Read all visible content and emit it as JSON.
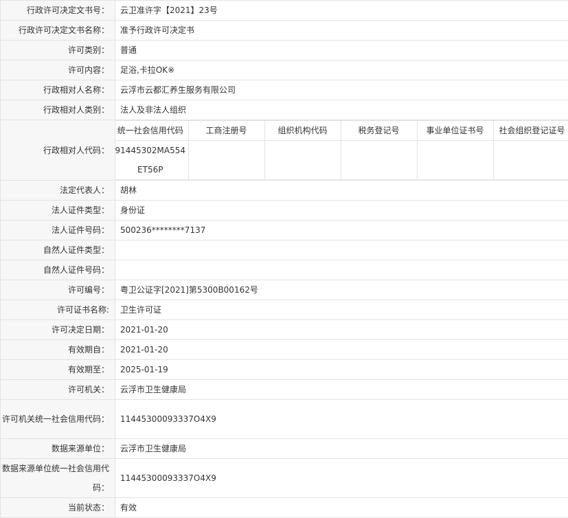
{
  "rows": [
    {
      "label": "行政许可决定文书号：",
      "value": "云卫准许字【2021】23号"
    },
    {
      "label": "行政许可决定文书名称：",
      "value": "准予行政许可决定书"
    },
    {
      "label": "许可类别：",
      "value": "普通"
    },
    {
      "label": "许可内容：",
      "value": "足浴,卡拉OK※"
    },
    {
      "label": "行政相对人名称：",
      "value": "云浮市云都汇养生服务有限公司"
    },
    {
      "label": "行政相对人类别：",
      "value": "法人及非法人组织"
    }
  ],
  "codes": {
    "label": "行政相对人代码：",
    "headers": [
      "统一社会信用代码",
      "工商注册号",
      "组织机构代码",
      "税务登记号",
      "事业单位证书号",
      "社会组织登记证号"
    ],
    "values": [
      "91445302MA554ET56P",
      "",
      "",
      "",
      "",
      ""
    ]
  },
  "rows2": [
    {
      "label": "法定代表人：",
      "value": "胡林"
    },
    {
      "label": "法人证件类型：",
      "value": "身份证"
    },
    {
      "label": "法人证件号码：",
      "value": "500236********7137"
    },
    {
      "label": "自然人证件类型：",
      "value": ""
    },
    {
      "label": "自然人证件号码：",
      "value": ""
    },
    {
      "label": "许可编号：",
      "value": "粤卫公证字[2021]第5300B00162号"
    },
    {
      "label": "许可证书名称:",
      "value": "卫生许可证"
    },
    {
      "label": "许可决定日期：",
      "value": "2021-01-20"
    },
    {
      "label": "有效期自：",
      "value": "2021-01-20"
    },
    {
      "label": "有效期至：",
      "value": "2025-01-19"
    },
    {
      "label": "许可机关：",
      "value": "云浮市卫生健康局"
    }
  ],
  "authority_code": {
    "label": "许可机关统一社会信用代码：",
    "value": "11445300093337O4X9"
  },
  "source_unit": {
    "label": "数据来源单位：",
    "value": "云浮市卫生健康局"
  },
  "source_code": {
    "label": "数据来源单位统一社会信用代码：",
    "value": "11445300093337O4X9"
  },
  "status": {
    "label": "当前状态：",
    "value": "有效"
  }
}
